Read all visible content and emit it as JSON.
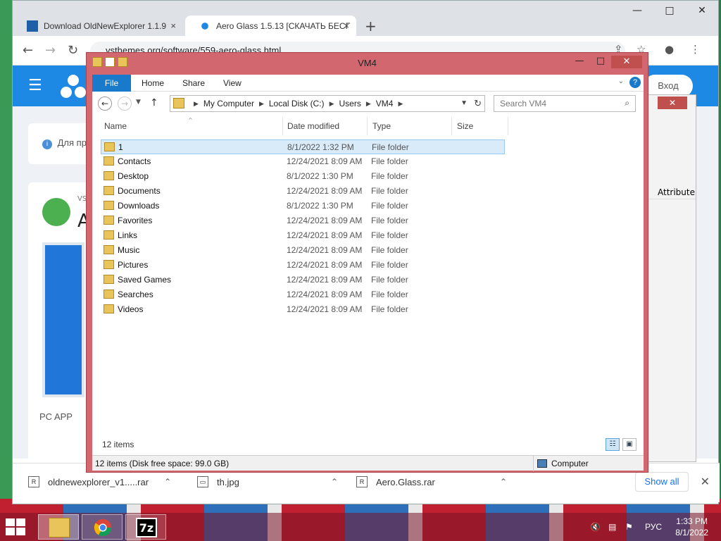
{
  "browser": {
    "tabs": [
      {
        "title": "Download OldNewExplorer 1.1.9",
        "close": "×"
      },
      {
        "title": "Aero Glass 1.5.13 [СКАЧАТЬ БЕСП",
        "close": "×"
      }
    ],
    "new_tab": "+",
    "window_controls": [
      "—",
      "□",
      "✕"
    ],
    "url": "vsthemes.org/software/559-aero-glass.html",
    "nav": {
      "back": "←",
      "forward": "→",
      "reload": "↻"
    },
    "toolbar_icons": [
      "share-icon",
      "star-icon",
      "profile-icon",
      "menu-icon"
    ]
  },
  "site": {
    "login_label": "Вход",
    "notice_text": "Для пр",
    "card_small": "VS",
    "card_big": "A",
    "card_footer": "PC APP"
  },
  "background_window": {
    "close": "✕",
    "column_header": "Attribute"
  },
  "downloads": {
    "items": [
      {
        "name": "oldnewexplorer_v1.....rar",
        "icon": "winrar-icon"
      },
      {
        "name": "th.jpg",
        "icon": "image-icon"
      },
      {
        "name": "Aero.Glass.rar",
        "icon": "winrar-icon"
      }
    ],
    "show_all": "Show all",
    "close": "✕"
  },
  "explorer": {
    "title": "VM4",
    "window_controls": {
      "minimize": "—",
      "maximize": "□",
      "close": "✕"
    },
    "ribbon": {
      "file": "File",
      "tabs": [
        "Home",
        "Share",
        "View"
      ],
      "help": "?"
    },
    "breadcrumb": [
      "My Computer",
      "Local Disk (C:)",
      "Users",
      "VM4"
    ],
    "search_placeholder": "Search VM4",
    "columns": {
      "name": "Name",
      "date": "Date modified",
      "type": "Type",
      "size": "Size"
    },
    "files": [
      {
        "name": "1",
        "date": "8/1/2022 1:32 PM",
        "type": "File folder",
        "selected": true
      },
      {
        "name": "Contacts",
        "date": "12/24/2021 8:09 AM",
        "type": "File folder"
      },
      {
        "name": "Desktop",
        "date": "8/1/2022 1:30 PM",
        "type": "File folder"
      },
      {
        "name": "Documents",
        "date": "12/24/2021 8:09 AM",
        "type": "File folder"
      },
      {
        "name": "Downloads",
        "date": "8/1/2022 1:30 PM",
        "type": "File folder"
      },
      {
        "name": "Favorites",
        "date": "12/24/2021 8:09 AM",
        "type": "File folder"
      },
      {
        "name": "Links",
        "date": "12/24/2021 8:09 AM",
        "type": "File folder"
      },
      {
        "name": "Music",
        "date": "12/24/2021 8:09 AM",
        "type": "File folder"
      },
      {
        "name": "Pictures",
        "date": "12/24/2021 8:09 AM",
        "type": "File folder"
      },
      {
        "name": "Saved Games",
        "date": "12/24/2021 8:09 AM",
        "type": "File folder"
      },
      {
        "name": "Searches",
        "date": "12/24/2021 8:09 AM",
        "type": "File folder"
      },
      {
        "name": "Videos",
        "date": "12/24/2021 8:09 AM",
        "type": "File folder"
      }
    ],
    "item_count": "12 items",
    "status_left": "12 items (Disk free space: 99.0 GB)",
    "status_right": "Computer"
  },
  "taskbar": {
    "apps": [
      "file-explorer-icon",
      "chrome-icon",
      "7zip-icon"
    ],
    "seven_zip_label": "7z",
    "language": "РУС",
    "time": "1:33 PM",
    "date": "8/1/2022"
  }
}
